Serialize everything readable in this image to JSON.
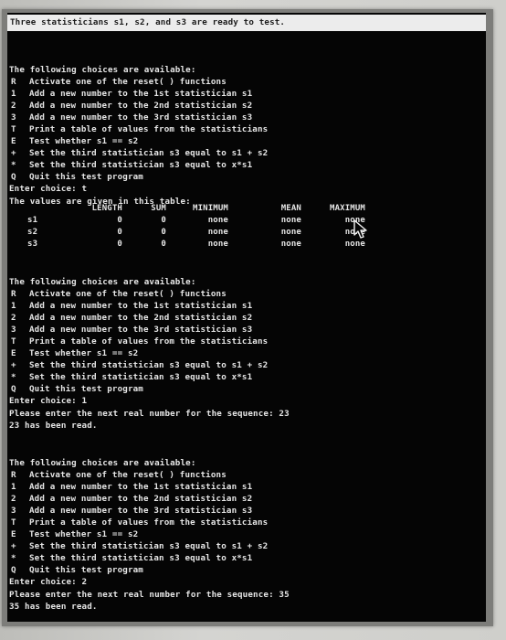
{
  "status_text": "Three statisticians s1, s2, and s3 are ready to test.",
  "menu_title": "The following choices are available:",
  "menu_items": [
    {
      "key": "R",
      "text": "Activate one of the reset( ) functions"
    },
    {
      "key": "1",
      "text": "Add a new number to the 1st statistician s1"
    },
    {
      "key": "2",
      "text": "Add a new number to the 2nd statistician s2"
    },
    {
      "key": "3",
      "text": "Add a new number to the 3rd statistician s3"
    },
    {
      "key": "T",
      "text": "Print a table of values from the statisticians"
    },
    {
      "key": "E",
      "text": "Test whether s1 == s2"
    },
    {
      "key": "+",
      "text": "Set the third statistician s3 equal to s1 + s2"
    },
    {
      "key": "*",
      "text": "Set the third statistician s3 equal to x*s1"
    },
    {
      "key": "Q",
      "text": "Quit this test program"
    }
  ],
  "sessions": [
    {
      "prompt": "Enter choice: t",
      "table": {
        "intro": "The values are given in this table:",
        "headers": [
          "LENGTH",
          "SUM",
          "MINIMUM",
          "MEAN",
          "MAXIMUM"
        ],
        "rows": [
          {
            "name": "s1",
            "length": "0",
            "sum": "0",
            "min": "none",
            "mean": "none",
            "max": "none"
          },
          {
            "name": "s2",
            "length": "0",
            "sum": "0",
            "min": "none",
            "mean": "none",
            "max": "none"
          },
          {
            "name": "s3",
            "length": "0",
            "sum": "0",
            "min": "none",
            "mean": "none",
            "max": "none"
          }
        ]
      }
    },
    {
      "prompt": "Enter choice: 1",
      "request": "Please enter the next real number for the sequence: 23",
      "result": "23 has been read."
    },
    {
      "prompt": "Enter choice: 2",
      "request": "Please enter the next real number for the sequence: 35",
      "result": "35 has been read."
    }
  ],
  "colors": {
    "console_bg": "#050505",
    "console_text": "#e6e6e6",
    "status_bg": "#ececec"
  }
}
